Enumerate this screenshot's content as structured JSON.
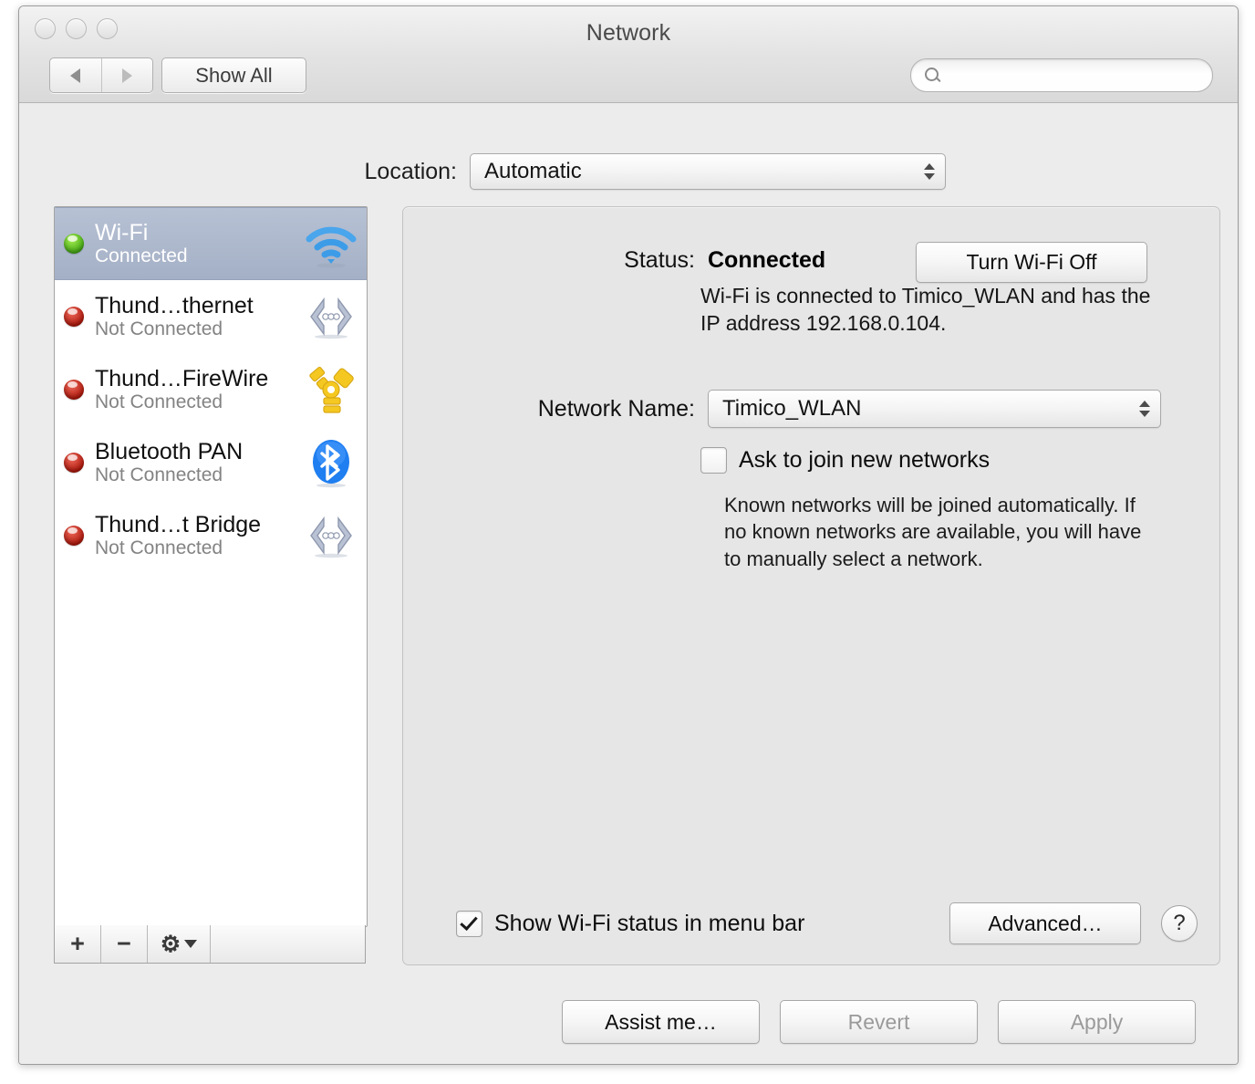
{
  "window": {
    "title": "Network",
    "traffic_lights": [
      "close",
      "minimize",
      "zoom"
    ]
  },
  "toolbar": {
    "back_icon": "back-arrow-icon",
    "forward_icon": "forward-arrow-icon",
    "show_all_label": "Show All",
    "search": {
      "icon": "search-icon",
      "value": "",
      "placeholder": ""
    }
  },
  "location": {
    "label": "Location:",
    "value": "Automatic"
  },
  "sidebar": {
    "services": [
      {
        "name": "Wi-Fi",
        "state": "Connected",
        "led": "green",
        "icon": "wifi-icon",
        "selected": true
      },
      {
        "name": "Thund…thernet",
        "state": "Not Connected",
        "led": "red",
        "icon": "ethernet-icon",
        "selected": false
      },
      {
        "name": "Thund…FireWire",
        "state": "Not Connected",
        "led": "red",
        "icon": "firewire-icon",
        "selected": false
      },
      {
        "name": "Bluetooth PAN",
        "state": "Not Connected",
        "led": "red",
        "icon": "bluetooth-icon",
        "selected": false
      },
      {
        "name": "Thund…t Bridge",
        "state": "Not Connected",
        "led": "red",
        "icon": "ethernet-icon",
        "selected": false
      }
    ],
    "toolbar": {
      "add_label": "+",
      "remove_label": "−",
      "gear_icon": "gear-icon"
    }
  },
  "main": {
    "status_label": "Status:",
    "status_value": "Connected",
    "turn_off_label": "Turn Wi-Fi Off",
    "status_description": "Wi-Fi is connected to Timico_WLAN and has the IP address 192.168.0.104.",
    "network_name_label": "Network Name:",
    "network_name_value": "Timico_WLAN",
    "ask_join_label": "Ask to join new networks",
    "ask_join_checked": false,
    "ask_join_help": "Known networks will be joined automatically. If no known networks are available, you will have to manually select a network.",
    "show_status_label": "Show Wi-Fi status in menu bar",
    "show_status_checked": true,
    "advanced_label": "Advanced…",
    "help_label": "?"
  },
  "footer": {
    "assist_label": "Assist me…",
    "revert_label": "Revert",
    "apply_label": "Apply",
    "revert_enabled": false,
    "apply_enabled": false
  },
  "colors": {
    "selection": "#a9b4c9",
    "led_connected": "#5fc017",
    "led_disconnected": "#c2190c",
    "window_bg": "#ececec",
    "panel_bg": "#e6e6e6"
  }
}
